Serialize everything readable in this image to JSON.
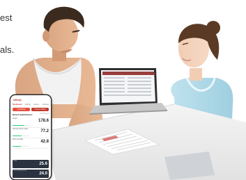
{
  "caption": {
    "line1": "est",
    "line2": "als."
  },
  "phone": {
    "brand": "InBody",
    "tabs": [
      "Dashboard",
      "InBody",
      "History",
      "Settings"
    ],
    "buttons": [
      "Add InBody",
      "Connect InBody"
    ],
    "report_title": "Recent Health Report",
    "report_date": "1/18 Results",
    "metrics": [
      {
        "label": "Height",
        "value": "178.6",
        "fill": 0.7
      },
      {
        "label": "Skeletal Muscle Mass",
        "value": "77.2",
        "fill": 0.55
      },
      {
        "label": "Body Fat Mass",
        "value": "42.8",
        "fill": 0.5
      }
    ],
    "dark_metrics": [
      {
        "label": "BMI",
        "value": "25.6"
      },
      {
        "label": "Percent Body Fat",
        "value": "24.0"
      }
    ]
  }
}
